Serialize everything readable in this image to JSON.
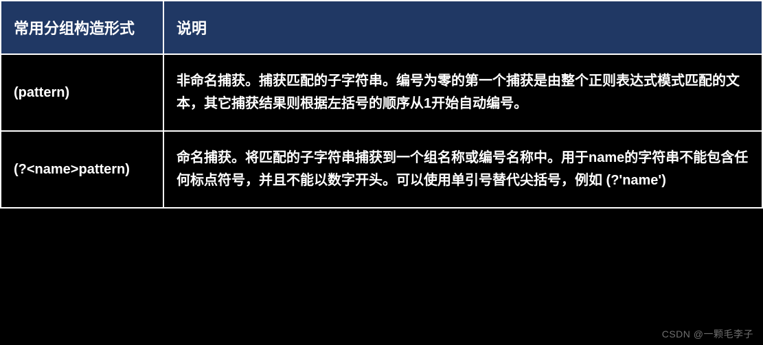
{
  "table": {
    "headers": [
      "常用分组构造形式",
      "说明"
    ],
    "rows": [
      {
        "form": "(pattern)",
        "desc": "非命名捕获。捕获匹配的子字符串。编号为零的第一个捕获是由整个正则表达式模式匹配的文本，其它捕获结果则根据左括号的顺序从1开始自动编号。"
      },
      {
        "form": "(?<name>pattern)",
        "desc": "命名捕获。将匹配的子字符串捕获到一个组名称或编号名称中。用于name的字符串不能包含任何标点符号，并且不能以数字开头。可以使用单引号替代尖括号，例如 (?'name')"
      }
    ]
  },
  "watermark": "CSDN @一颗毛李子"
}
